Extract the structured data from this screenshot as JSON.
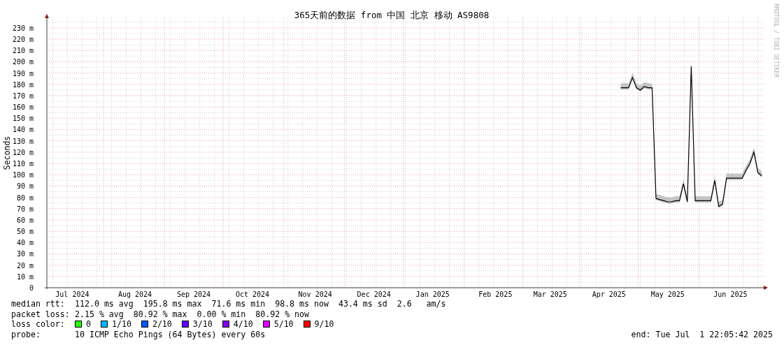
{
  "graph": {
    "title": "365天前的数据 from 中国 北京 移动 AS9808",
    "credit": "RRDTOOL / TOBI OETIKER",
    "chart_data": {
      "type": "line",
      "grid": true,
      "ylabel": "Seconds",
      "ylim": [
        0,
        235
      ],
      "yticks": [
        {
          "value": 0,
          "label": "0"
        },
        {
          "value": 10,
          "label": "10 m"
        },
        {
          "value": 20,
          "label": "20 m"
        },
        {
          "value": 30,
          "label": "30 m"
        },
        {
          "value": 40,
          "label": "40 m"
        },
        {
          "value": 50,
          "label": "50 m"
        },
        {
          "value": 60,
          "label": "60 m"
        },
        {
          "value": 70,
          "label": "70 m"
        },
        {
          "value": 80,
          "label": "80 m"
        },
        {
          "value": 90,
          "label": "90 m"
        },
        {
          "value": 100,
          "label": "100 m"
        },
        {
          "value": 110,
          "label": "110 m"
        },
        {
          "value": 120,
          "label": "120 m"
        },
        {
          "value": 130,
          "label": "130 m"
        },
        {
          "value": 140,
          "label": "140 m"
        },
        {
          "value": 150,
          "label": "150 m"
        },
        {
          "value": 160,
          "label": "160 m"
        },
        {
          "value": 170,
          "label": "170 m"
        },
        {
          "value": 180,
          "label": "180 m"
        },
        {
          "value": 190,
          "label": "190 m"
        },
        {
          "value": 200,
          "label": "200 m"
        },
        {
          "value": 210,
          "label": "210 m"
        },
        {
          "value": 220,
          "label": "220 m"
        },
        {
          "value": 230,
          "label": "230 m"
        }
      ],
      "categories": [
        null,
        null,
        null,
        null,
        null,
        null,
        "Jul 2024",
        null,
        null,
        null,
        null,
        null,
        null,
        null,
        null,
        null,
        null,
        null,
        null,
        null,
        null,
        null,
        "Aug 2024",
        null,
        null,
        null,
        null,
        null,
        null,
        null,
        null,
        null,
        null,
        null,
        null,
        null,
        null,
        "Sep 2024",
        null,
        null,
        null,
        null,
        null,
        null,
        null,
        null,
        null,
        null,
        null,
        null,
        null,
        null,
        "Oct 2024",
        null,
        null,
        null,
        null,
        null,
        null,
        null,
        null,
        null,
        null,
        null,
        null,
        null,
        null,
        null,
        "Nov 2024",
        null,
        null,
        null,
        null,
        null,
        null,
        null,
        null,
        null,
        null,
        null,
        null,
        null,
        null,
        "Dec 2024",
        null,
        null,
        null,
        null,
        null,
        null,
        null,
        null,
        null,
        null,
        null,
        null,
        null,
        null,
        "Jan 2025",
        null,
        null,
        null,
        null,
        null,
        null,
        null,
        null,
        null,
        null,
        null,
        null,
        null,
        null,
        null,
        "Feb 2025",
        null,
        null,
        null,
        null,
        null,
        null,
        null,
        null,
        null,
        null,
        null,
        null,
        null,
        "Mar 2025",
        null,
        null,
        null,
        null,
        null,
        null,
        null,
        null,
        null,
        null,
        null,
        null,
        null,
        null,
        "Apr 2025",
        null,
        null,
        null,
        null,
        null,
        null,
        null,
        null,
        null,
        null,
        null,
        null,
        null,
        null,
        "May 2025",
        null,
        null,
        null,
        null,
        null,
        null,
        null,
        null,
        null,
        null,
        null,
        null,
        null,
        null,
        null,
        "Jun 2025",
        null,
        null,
        null,
        null,
        null,
        null,
        null,
        null
      ],
      "series": [
        {
          "color": "#000000",
          "values": [
            null,
            null,
            null,
            null,
            null,
            null,
            null,
            null,
            null,
            null,
            null,
            null,
            null,
            null,
            null,
            null,
            null,
            null,
            null,
            null,
            null,
            null,
            null,
            null,
            null,
            null,
            null,
            null,
            null,
            null,
            null,
            null,
            null,
            null,
            null,
            null,
            null,
            null,
            null,
            null,
            null,
            null,
            null,
            null,
            null,
            null,
            null,
            null,
            null,
            null,
            null,
            null,
            null,
            null,
            null,
            null,
            null,
            null,
            null,
            null,
            null,
            null,
            null,
            null,
            null,
            null,
            null,
            null,
            null,
            null,
            null,
            null,
            null,
            null,
            null,
            null,
            null,
            null,
            null,
            null,
            null,
            null,
            null,
            null,
            null,
            null,
            null,
            null,
            null,
            null,
            null,
            null,
            null,
            null,
            null,
            null,
            null,
            null,
            null,
            null,
            null,
            null,
            null,
            null,
            null,
            null,
            null,
            null,
            null,
            null,
            null,
            null,
            null,
            null,
            null,
            null,
            null,
            null,
            null,
            null,
            null,
            null,
            null,
            null,
            null,
            null,
            null,
            null,
            null,
            null,
            null,
            null,
            null,
            null,
            null,
            null,
            null,
            null,
            null,
            null,
            null,
            null,
            null,
            null,
            null,
            null,
            177,
            177,
            177,
            186,
            177,
            175,
            178,
            177,
            177,
            79,
            78,
            77,
            76,
            76,
            77,
            77,
            92,
            76,
            196,
            77,
            77,
            77,
            77,
            77,
            95,
            72,
            74,
            97,
            97,
            97,
            97,
            97,
            104,
            110,
            120,
            102,
            99
          ]
        }
      ]
    }
  },
  "stats": [
    {
      "label": "median rtt:",
      "value": "112.0 ms avg  195.8 ms max  71.6 ms min  98.8 ms now  43.4 ms sd  2.6   am/s"
    },
    {
      "label": "packet loss:",
      "value": "2.15 % avg  80.92 % max  0.00 % min  80.92 % now"
    }
  ],
  "loss_color": {
    "label": "loss color:",
    "items": [
      {
        "label": "0",
        "color": "#26ff00"
      },
      {
        "label": "1/10",
        "color": "#00b8ff"
      },
      {
        "label": "2/10",
        "color": "#0059ff"
      },
      {
        "label": "3/10",
        "color": "#5e00ff"
      },
      {
        "label": "4/10",
        "color": "#7e00ff"
      },
      {
        "label": "5/10",
        "color": "#dd00ff"
      },
      {
        "label": "9/10",
        "color": "#ff0000"
      }
    ]
  },
  "probe": {
    "label": "probe:",
    "value": "10 ICMP Echo Pings (64 Bytes) every 60s"
  },
  "end": "end: Tue Jul  1 22:05:42 2025"
}
